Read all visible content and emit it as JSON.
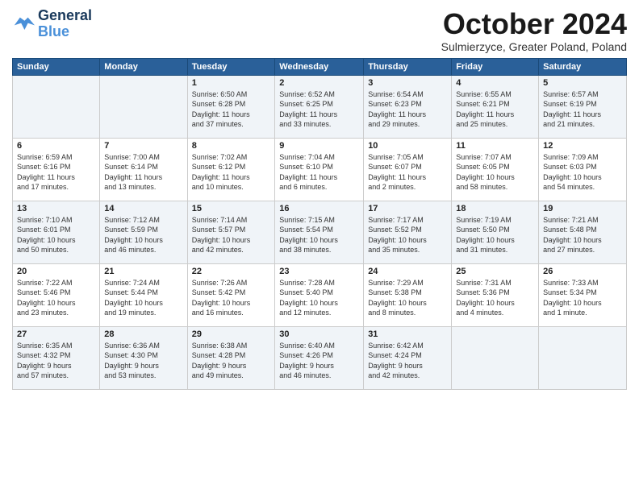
{
  "logo": {
    "line1": "General",
    "line2": "Blue"
  },
  "title": "October 2024",
  "subtitle": "Sulmierzyce, Greater Poland, Poland",
  "days_of_week": [
    "Sunday",
    "Monday",
    "Tuesday",
    "Wednesday",
    "Thursday",
    "Friday",
    "Saturday"
  ],
  "weeks": [
    [
      {
        "day": "",
        "info": ""
      },
      {
        "day": "",
        "info": ""
      },
      {
        "day": "1",
        "info": "Sunrise: 6:50 AM\nSunset: 6:28 PM\nDaylight: 11 hours\nand 37 minutes."
      },
      {
        "day": "2",
        "info": "Sunrise: 6:52 AM\nSunset: 6:25 PM\nDaylight: 11 hours\nand 33 minutes."
      },
      {
        "day": "3",
        "info": "Sunrise: 6:54 AM\nSunset: 6:23 PM\nDaylight: 11 hours\nand 29 minutes."
      },
      {
        "day": "4",
        "info": "Sunrise: 6:55 AM\nSunset: 6:21 PM\nDaylight: 11 hours\nand 25 minutes."
      },
      {
        "day": "5",
        "info": "Sunrise: 6:57 AM\nSunset: 6:19 PM\nDaylight: 11 hours\nand 21 minutes."
      }
    ],
    [
      {
        "day": "6",
        "info": "Sunrise: 6:59 AM\nSunset: 6:16 PM\nDaylight: 11 hours\nand 17 minutes."
      },
      {
        "day": "7",
        "info": "Sunrise: 7:00 AM\nSunset: 6:14 PM\nDaylight: 11 hours\nand 13 minutes."
      },
      {
        "day": "8",
        "info": "Sunrise: 7:02 AM\nSunset: 6:12 PM\nDaylight: 11 hours\nand 10 minutes."
      },
      {
        "day": "9",
        "info": "Sunrise: 7:04 AM\nSunset: 6:10 PM\nDaylight: 11 hours\nand 6 minutes."
      },
      {
        "day": "10",
        "info": "Sunrise: 7:05 AM\nSunset: 6:07 PM\nDaylight: 11 hours\nand 2 minutes."
      },
      {
        "day": "11",
        "info": "Sunrise: 7:07 AM\nSunset: 6:05 PM\nDaylight: 10 hours\nand 58 minutes."
      },
      {
        "day": "12",
        "info": "Sunrise: 7:09 AM\nSunset: 6:03 PM\nDaylight: 10 hours\nand 54 minutes."
      }
    ],
    [
      {
        "day": "13",
        "info": "Sunrise: 7:10 AM\nSunset: 6:01 PM\nDaylight: 10 hours\nand 50 minutes."
      },
      {
        "day": "14",
        "info": "Sunrise: 7:12 AM\nSunset: 5:59 PM\nDaylight: 10 hours\nand 46 minutes."
      },
      {
        "day": "15",
        "info": "Sunrise: 7:14 AM\nSunset: 5:57 PM\nDaylight: 10 hours\nand 42 minutes."
      },
      {
        "day": "16",
        "info": "Sunrise: 7:15 AM\nSunset: 5:54 PM\nDaylight: 10 hours\nand 38 minutes."
      },
      {
        "day": "17",
        "info": "Sunrise: 7:17 AM\nSunset: 5:52 PM\nDaylight: 10 hours\nand 35 minutes."
      },
      {
        "day": "18",
        "info": "Sunrise: 7:19 AM\nSunset: 5:50 PM\nDaylight: 10 hours\nand 31 minutes."
      },
      {
        "day": "19",
        "info": "Sunrise: 7:21 AM\nSunset: 5:48 PM\nDaylight: 10 hours\nand 27 minutes."
      }
    ],
    [
      {
        "day": "20",
        "info": "Sunrise: 7:22 AM\nSunset: 5:46 PM\nDaylight: 10 hours\nand 23 minutes."
      },
      {
        "day": "21",
        "info": "Sunrise: 7:24 AM\nSunset: 5:44 PM\nDaylight: 10 hours\nand 19 minutes."
      },
      {
        "day": "22",
        "info": "Sunrise: 7:26 AM\nSunset: 5:42 PM\nDaylight: 10 hours\nand 16 minutes."
      },
      {
        "day": "23",
        "info": "Sunrise: 7:28 AM\nSunset: 5:40 PM\nDaylight: 10 hours\nand 12 minutes."
      },
      {
        "day": "24",
        "info": "Sunrise: 7:29 AM\nSunset: 5:38 PM\nDaylight: 10 hours\nand 8 minutes."
      },
      {
        "day": "25",
        "info": "Sunrise: 7:31 AM\nSunset: 5:36 PM\nDaylight: 10 hours\nand 4 minutes."
      },
      {
        "day": "26",
        "info": "Sunrise: 7:33 AM\nSunset: 5:34 PM\nDaylight: 10 hours\nand 1 minute."
      }
    ],
    [
      {
        "day": "27",
        "info": "Sunrise: 6:35 AM\nSunset: 4:32 PM\nDaylight: 9 hours\nand 57 minutes."
      },
      {
        "day": "28",
        "info": "Sunrise: 6:36 AM\nSunset: 4:30 PM\nDaylight: 9 hours\nand 53 minutes."
      },
      {
        "day": "29",
        "info": "Sunrise: 6:38 AM\nSunset: 4:28 PM\nDaylight: 9 hours\nand 49 minutes."
      },
      {
        "day": "30",
        "info": "Sunrise: 6:40 AM\nSunset: 4:26 PM\nDaylight: 9 hours\nand 46 minutes."
      },
      {
        "day": "31",
        "info": "Sunrise: 6:42 AM\nSunset: 4:24 PM\nDaylight: 9 hours\nand 42 minutes."
      },
      {
        "day": "",
        "info": ""
      },
      {
        "day": "",
        "info": ""
      }
    ]
  ]
}
